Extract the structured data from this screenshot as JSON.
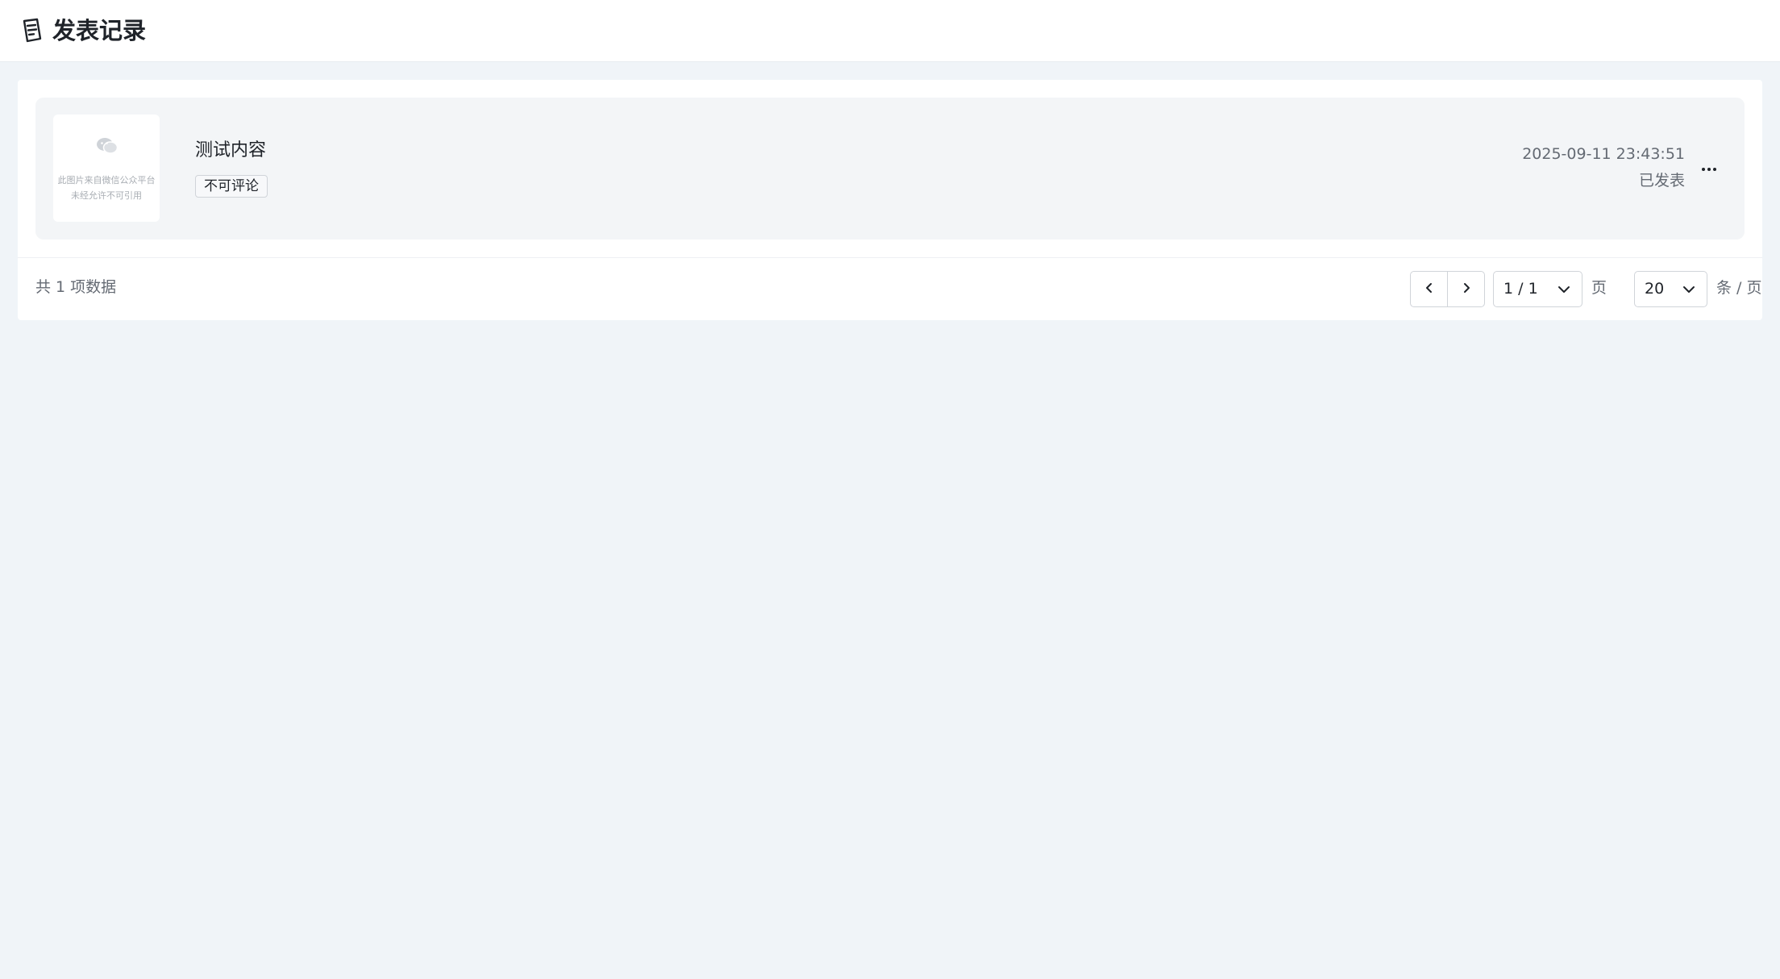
{
  "header": {
    "title": "发表记录",
    "icon": "document-icon"
  },
  "records": [
    {
      "thumbnail": {
        "icon": "wechat-icon",
        "line1": "此图片来自微信公众平台",
        "line2": "未经允许不可引用"
      },
      "title": "测试内容",
      "tag": "不可评论",
      "datetime": "2025-09-11 23:43:51",
      "status": "已发表",
      "more_icon": "more-horizontal-icon"
    }
  ],
  "pagination": {
    "total_text": "共 1 项数据",
    "prev_icon": "chevron-left-icon",
    "next_icon": "chevron-right-icon",
    "page_value": "1 / 1",
    "page_suffix": "页",
    "page_size_value": "20",
    "page_size_suffix": "条 / 页"
  }
}
